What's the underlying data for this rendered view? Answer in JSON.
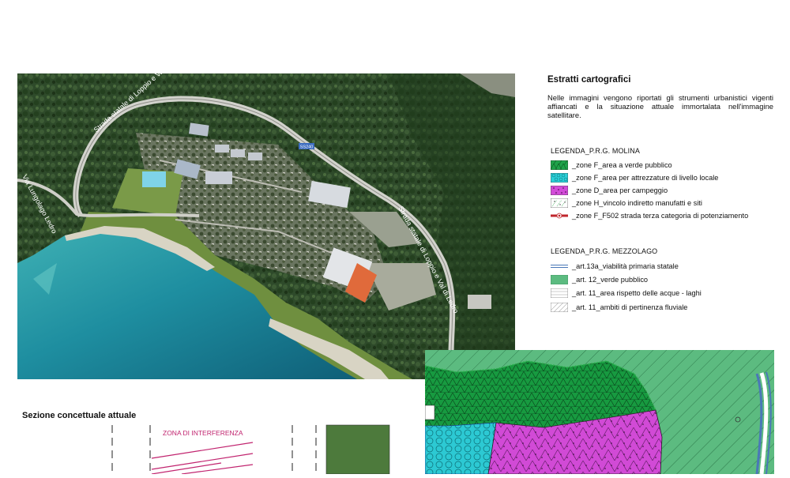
{
  "sidebar": {
    "title": "Estratti cartografici",
    "description": "Nelle immagini vengono riportati gli strumenti urbanistici vigenti affiancati e la situazione attuale immortalata nell'immagine satellitare."
  },
  "legend_molina": {
    "title": "LEGENDA_P.R.G. MOLINA",
    "items": [
      {
        "label": "_zone F_area a verde pubblico",
        "color": "#1fa34a",
        "icon": "green-triangle-hatch-swatch"
      },
      {
        "label": "_zone F_area per attrezzature di livello locale",
        "color": "#29d0d8",
        "icon": "cyan-hex-swatch"
      },
      {
        "label": "_zone D_area per campeggio",
        "color": "#d24bd8",
        "icon": "magenta-dotted-swatch"
      },
      {
        "label": "_zone H_vincolo indiretto manufatti e siti",
        "color": "#ffffff",
        "icon": "white-dotted-swatch"
      },
      {
        "label": "_zone F_F502 strada terza categoria di potenziamento",
        "color": "#c0272d",
        "icon": "red-road-line-swatch"
      }
    ]
  },
  "legend_mezzolago": {
    "title": "LEGENDA_P.R.G. MEZZOLAGO",
    "items": [
      {
        "label": "_art.13a_viabilità primaria statale",
        "color": "#4a78b8",
        "icon": "blue-line-swatch"
      },
      {
        "label": "_art. 12_verde pubblico",
        "color": "#5cbb80",
        "icon": "green-fill-swatch"
      },
      {
        "label": "_art. 11_area rispetto delle acque - laghi",
        "color": "#aaaaaa",
        "icon": "gray-lines-swatch"
      },
      {
        "label": "_art. 11_ambiti di pertinenza fluviale",
        "color": "#bbbbbb",
        "icon": "diagonal-hatch-swatch"
      }
    ]
  },
  "satellite": {
    "road_label_1": "Strada statale di Loppio e Val di Ledro",
    "road_label_2": "Via Lungolago Ledro",
    "road_label_3": "Strada statale di Loppio e Val di Ledro",
    "road_badge": "SS240"
  },
  "section": {
    "title": "Sezione concettuale attuale",
    "zone_label": "ZONA DI INTERFERENZA"
  }
}
